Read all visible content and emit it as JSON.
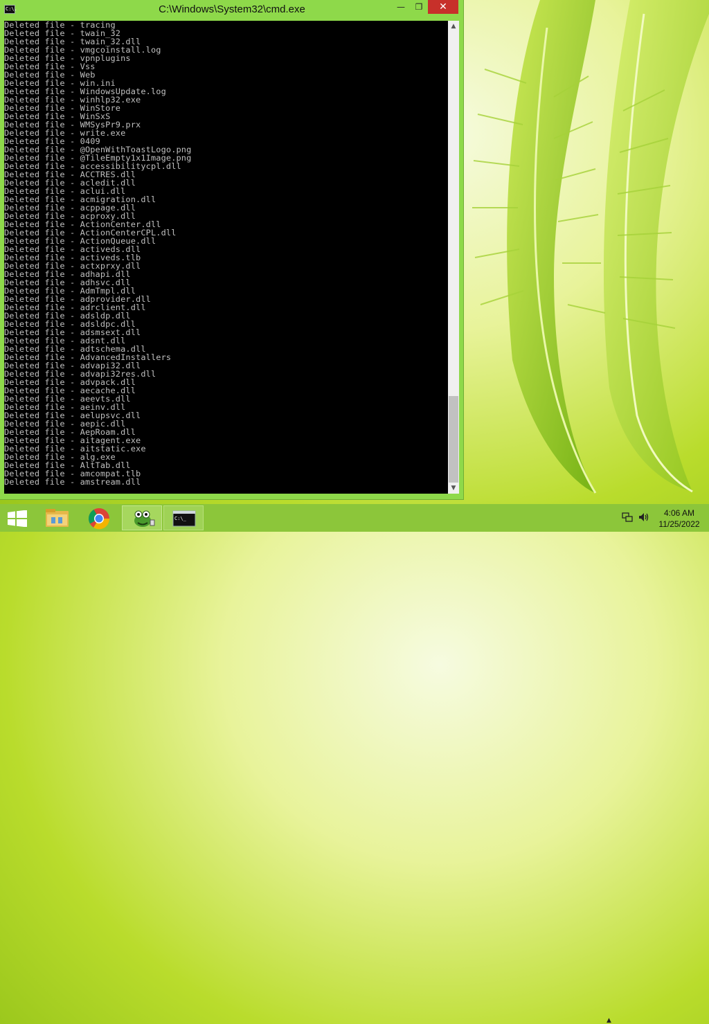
{
  "window": {
    "title": "C:\\Windows\\System32\\cmd.exe",
    "icon_text": "C:\\.",
    "controls": {
      "minimize": "minimize-icon",
      "maximize": "restore-icon",
      "close": "close-icon"
    }
  },
  "console": {
    "lines": [
      "Deleted file - tracing",
      "Deleted file - twain_32",
      "Deleted file - twain_32.dll",
      "Deleted file - vmgcoinstall.log",
      "Deleted file - vpnplugins",
      "Deleted file - Vss",
      "Deleted file - Web",
      "Deleted file - win.ini",
      "Deleted file - WindowsUpdate.log",
      "Deleted file - winhlp32.exe",
      "Deleted file - WinStore",
      "Deleted file - WinSxS",
      "Deleted file - WMSysPr9.prx",
      "Deleted file - write.exe",
      "Deleted file - 0409",
      "Deleted file - @OpenWithToastLogo.png",
      "Deleted file - @TileEmpty1x1Image.png",
      "Deleted file - accessibilitycpl.dll",
      "Deleted file - ACCTRES.dll",
      "Deleted file - acledit.dll",
      "Deleted file - aclui.dll",
      "Deleted file - acmigration.dll",
      "Deleted file - acppage.dll",
      "Deleted file - acproxy.dll",
      "Deleted file - ActionCenter.dll",
      "Deleted file - ActionCenterCPL.dll",
      "Deleted file - ActionQueue.dll",
      "Deleted file - activeds.dll",
      "Deleted file - activeds.tlb",
      "Deleted file - actxprxy.dll",
      "Deleted file - adhapi.dll",
      "Deleted file - adhsvc.dll",
      "Deleted file - AdmTmpl.dll",
      "Deleted file - adprovider.dll",
      "Deleted file - adrclient.dll",
      "Deleted file - adsldp.dll",
      "Deleted file - adsldpc.dll",
      "Deleted file - adsmsext.dll",
      "Deleted file - adsnt.dll",
      "Deleted file - adtschema.dll",
      "Deleted file - AdvancedInstallers",
      "Deleted file - advapi32.dll",
      "Deleted file - advapi32res.dll",
      "Deleted file - advpack.dll",
      "Deleted file - aecache.dll",
      "Deleted file - aeevts.dll",
      "Deleted file - aeinv.dll",
      "Deleted file - aelupsvc.dll",
      "Deleted file - aepic.dll",
      "Deleted file - AepRoam.dll",
      "Deleted file - aitagent.exe",
      "Deleted file - aitstatic.exe",
      "Deleted file - alg.exe",
      "Deleted file - AltTab.dll",
      "Deleted file - amcompat.tlb",
      "Deleted file - amstream.dll"
    ],
    "scroll_position": 0.93
  },
  "taskbar": {
    "items": [
      {
        "name": "file-explorer",
        "icon": "folder-icon",
        "state": "normal"
      },
      {
        "name": "chrome",
        "icon": "chrome-icon",
        "state": "normal"
      },
      {
        "name": "mascot-app",
        "icon": "frog-icon",
        "state": "open"
      },
      {
        "name": "cmd",
        "icon": "console-icon",
        "icon_text": "C:\\_",
        "state": "active"
      }
    ],
    "tray": {
      "icons": [
        "show-hidden-icons-arrow",
        "network-icon",
        "volume-icon"
      ]
    },
    "clock": {
      "time": "4:06 AM",
      "date": "11/25/2022"
    }
  },
  "colors": {
    "window_frame": "#8ed94a",
    "close_button": "#c7302a",
    "console_bg": "#000000",
    "console_fg": "#c0c0c0",
    "taskbar": "#8cc63a"
  }
}
